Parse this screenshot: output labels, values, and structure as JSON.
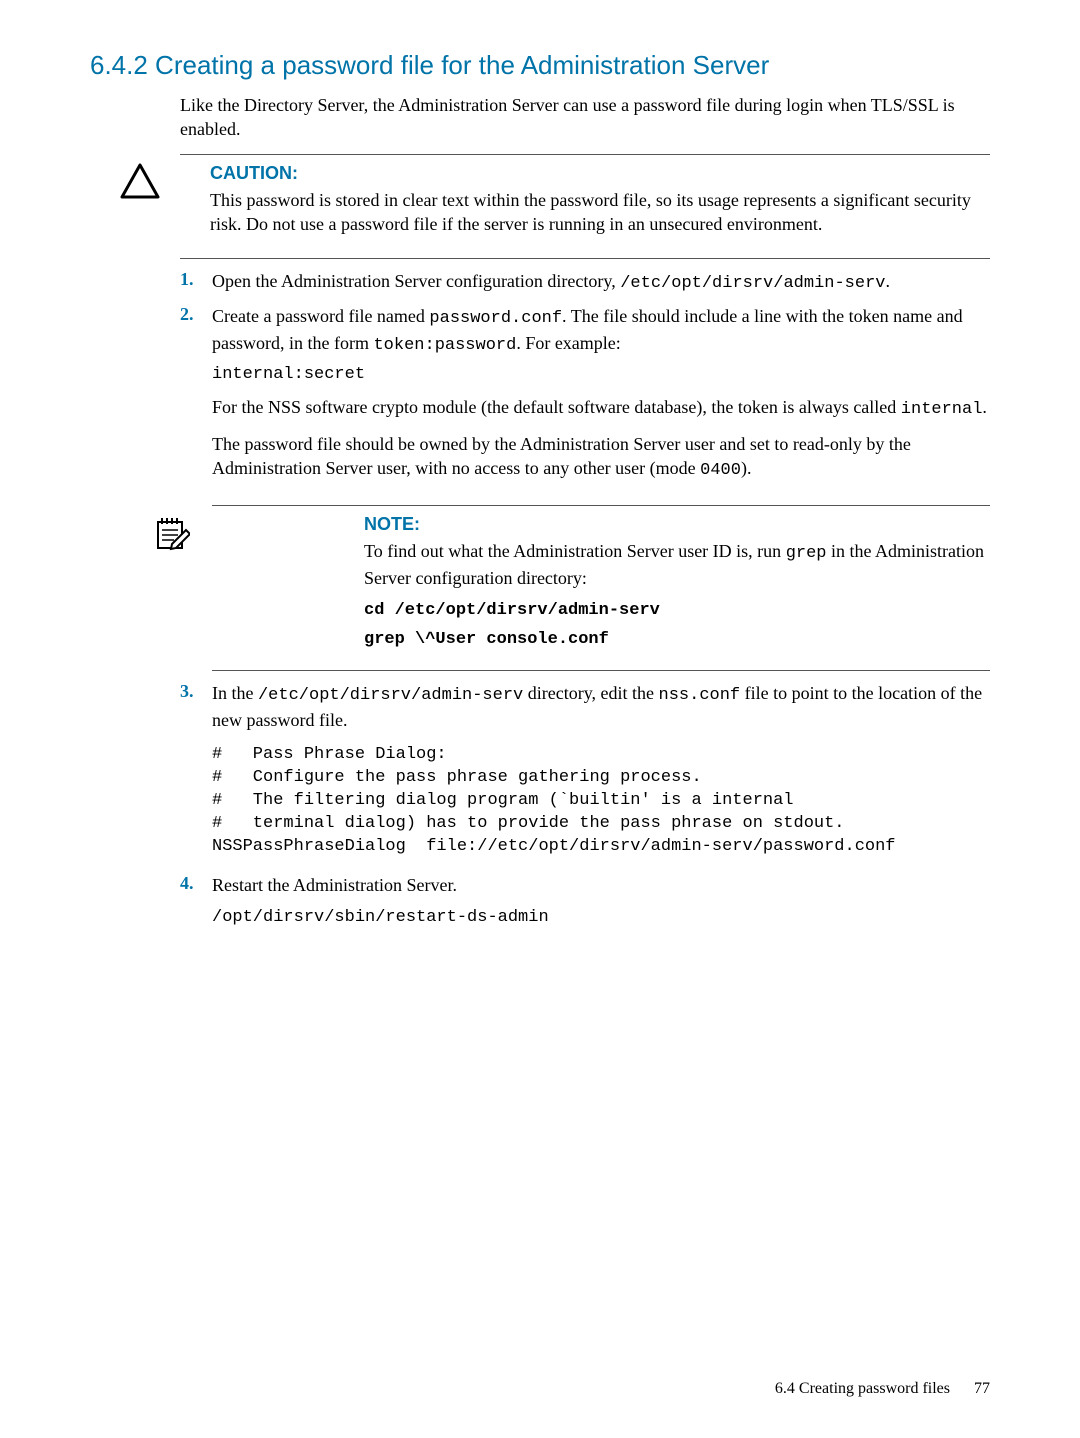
{
  "heading": "6.4.2 Creating a password file for the Administration Server",
  "intro": "Like the Directory Server, the Administration Server can use a password file during login when TLS/SSL is enabled.",
  "caution": {
    "label": "CAUTION:",
    "text": "This password is stored in clear text within the password file, so its usage represents a significant security risk. Do not use a password file if the server is running in an unsecured environment."
  },
  "steps": {
    "1": {
      "num": "1.",
      "pre": "Open the Administration Server configuration directory, ",
      "code": "/etc/opt/dirsrv/admin-serv",
      "post": "."
    },
    "2": {
      "num": "2.",
      "line1_pre": "Create a password file named ",
      "line1_code1": "password.conf",
      "line1_mid": ". The file should include a line with the token name and password, in the form ",
      "line1_code2": "token:password",
      "line1_post": ". For example:",
      "code_example": "internal:secret",
      "para2_pre": "For the NSS software crypto module (the default software database), the token is always called ",
      "para2_code": "internal",
      "para2_post": ".",
      "para3_pre": "The password file should be owned by the Administration Server user and set to read-only by the Administration Server user, with no access to any other user (mode ",
      "para3_code": "0400",
      "para3_post": ")."
    },
    "3": {
      "num": "3.",
      "line_pre": "In the ",
      "line_code1": "/etc/opt/dirsrv/admin-serv",
      "line_mid": " directory, edit the ",
      "line_code2": "nss.conf",
      "line_post": " file to point to the location of the new password file.",
      "code_block": "#   Pass Phrase Dialog:\n#   Configure the pass phrase gathering process.\n#   The filtering dialog program (`builtin' is a internal\n#   terminal dialog) has to provide the pass phrase on stdout.\nNSSPassPhraseDialog  file://etc/opt/dirsrv/admin-serv/password.conf"
    },
    "4": {
      "num": "4.",
      "text": "Restart the Administration Server.",
      "code_block": "/opt/dirsrv/sbin/restart-ds-admin"
    }
  },
  "note": {
    "label": "NOTE:",
    "text_pre": "To find out what the Administration Server user ID is, run ",
    "text_code": "grep",
    "text_post": " in the Administration Server configuration directory:",
    "cmd1": "cd /etc/opt/dirsrv/admin-serv",
    "cmd2": "grep \\^User console.conf"
  },
  "footer": {
    "section": "6.4 Creating password files",
    "page": "77"
  }
}
